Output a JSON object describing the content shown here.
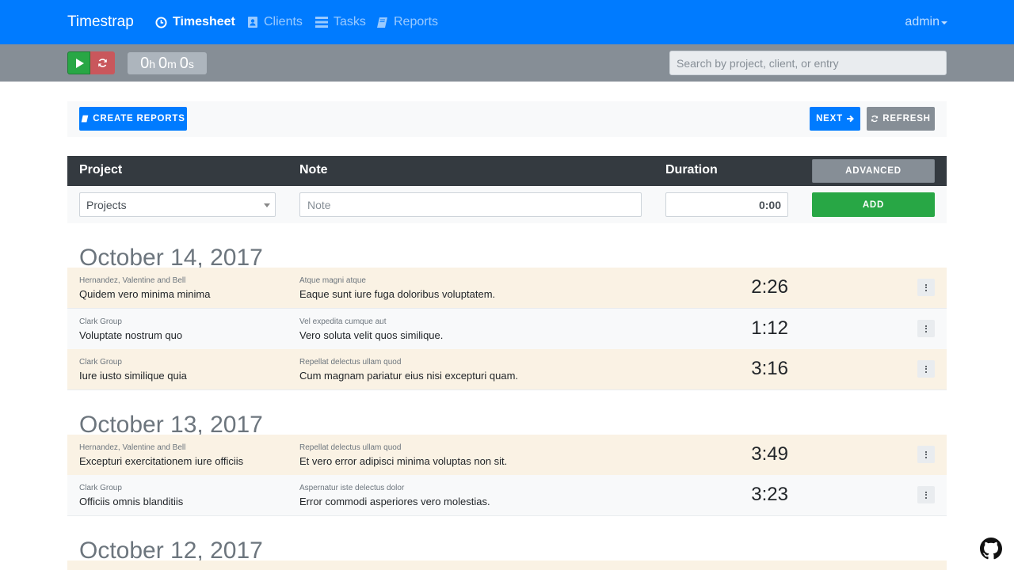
{
  "app": {
    "brand": "Timestrap"
  },
  "nav": {
    "items": [
      {
        "label": "Timesheet",
        "icon": "clock-icon",
        "active": true
      },
      {
        "label": "Clients",
        "icon": "address-book-icon",
        "active": false
      },
      {
        "label": "Tasks",
        "icon": "tasks-icon",
        "active": false
      },
      {
        "label": "Reports",
        "icon": "book-icon",
        "active": false
      }
    ],
    "user": "admin"
  },
  "timer": {
    "hours": "0",
    "hours_unit": "h",
    "minutes": "0",
    "minutes_unit": "m",
    "seconds": "0",
    "seconds_unit": "s"
  },
  "search": {
    "placeholder": "Search by project, client, or entry"
  },
  "actions": {
    "create_reports": "CREATE REPORTS",
    "next": "NEXT",
    "refresh": "REFRESH"
  },
  "entry_form": {
    "project_header": "Project",
    "note_header": "Note",
    "duration_header": "Duration",
    "advanced": "ADVANCED",
    "project_value": "Projects",
    "note_placeholder": "Note",
    "duration_value": "0:00",
    "add": "ADD"
  },
  "days": [
    {
      "date": "October 14, 2017",
      "entries": [
        {
          "client": "Hernandez, Valentine and Bell",
          "project": "Quidem vero minima minima",
          "task": "Atque magni atque",
          "note": "Eaque sunt iure fuga doloribus voluptatem.",
          "duration": "2:26"
        },
        {
          "client": "Clark Group",
          "project": "Voluptate nostrum quo",
          "task": "Vel expedita cumque aut",
          "note": "Vero soluta velit quos similique.",
          "duration": "1:12"
        },
        {
          "client": "Clark Group",
          "project": "Iure iusto similique quia",
          "task": "Repellat delectus ullam quod",
          "note": "Cum magnam pariatur eius nisi excepturi quam.",
          "duration": "3:16"
        }
      ]
    },
    {
      "date": "October 13, 2017",
      "entries": [
        {
          "client": "Hernandez, Valentine and Bell",
          "project": "Excepturi exercitationem iure officiis",
          "task": "Repellat delectus ullam quod",
          "note": "Et vero error adipisci minima voluptas non sit.",
          "duration": "3:49"
        },
        {
          "client": "Clark Group",
          "project": "Officiis omnis blanditiis",
          "task": "Aspernatur iste delectus dolor",
          "note": "Error commodi asperiores vero molestias.",
          "duration": "3:23"
        }
      ]
    },
    {
      "date": "October 12, 2017",
      "entries": []
    }
  ],
  "colors": {
    "primary": "#007bff",
    "success": "#28a745",
    "secondary": "#868e96",
    "dark": "#343a40",
    "danger": "#c9575c"
  }
}
